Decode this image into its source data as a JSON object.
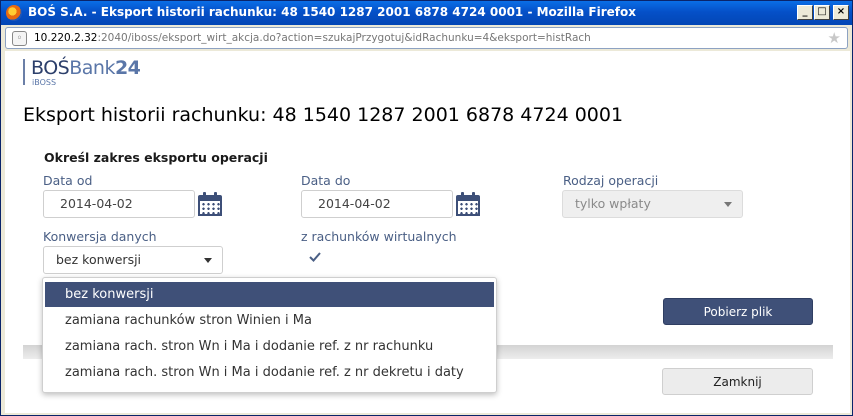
{
  "window": {
    "title": "BOŚ S.A. - Eksport historii rachunku: 48 1540 1287 2001 6878 4724 0001 - Mozilla Firefox",
    "min_label": "_",
    "max_label": "□",
    "close_label": "×"
  },
  "urlbar": {
    "host": "10.220.2.32",
    "path": ":2040/iboss/eksport_wirt_akcja.do?action=szukajPrzygotuj&idRachunku=4&eksport=histRach"
  },
  "logo": {
    "bos": "BOŚ",
    "bank": "Bank",
    "num": "24",
    "sub": "iBOSS"
  },
  "page": {
    "title": "Eksport historii rachunku: 48 1540 1287 2001 6878 4724 0001",
    "section_title": "Określ zakres eksportu operacji"
  },
  "form": {
    "date_from": {
      "label": "Data od",
      "value": "2014-04-02"
    },
    "date_to": {
      "label": "Data do",
      "value": "2014-04-02"
    },
    "operation_type": {
      "label": "Rodzaj operacji",
      "value": "tylko wpłaty"
    },
    "conversion": {
      "label": "Konwersja danych",
      "value": "bez konwersji"
    },
    "virtual_accounts": {
      "label": "z rachunków wirtualnych",
      "checked": true
    }
  },
  "dropdown": {
    "options": [
      "bez konwersji",
      "zamiana rachunków stron Winien i Ma",
      "zamiana rach. stron Wn i Ma i dodanie ref. z nr rachunku",
      "zamiana rach. stron Wn i Ma i dodanie ref. z nr dekretu i daty"
    ],
    "selected_index": 0
  },
  "buttons": {
    "download": "Pobierz plik",
    "close": "Zamknij"
  },
  "colors": {
    "accent": "#3f5078",
    "label": "#4a5f85"
  }
}
